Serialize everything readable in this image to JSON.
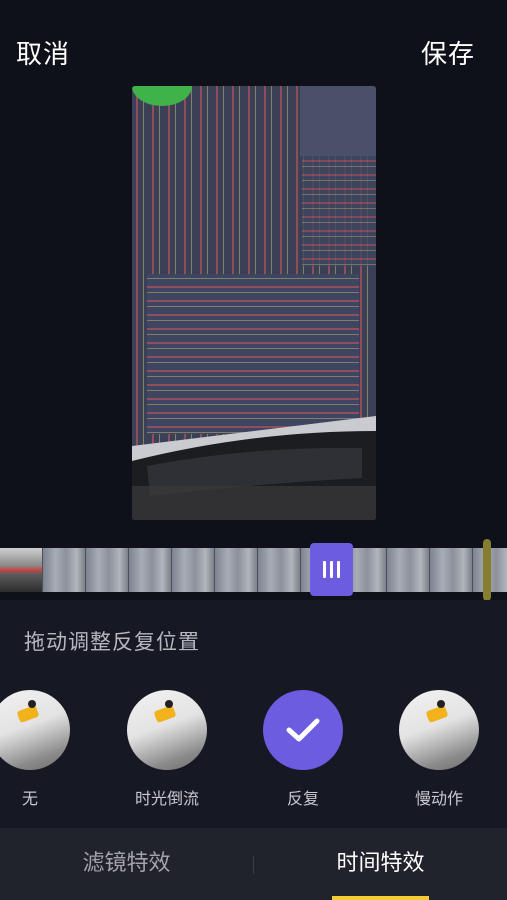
{
  "header": {
    "cancel_label": "取消",
    "save_label": "保存"
  },
  "timeline": {
    "frame_count": 12
  },
  "hint": "拖动调整反复位置",
  "effects": [
    {
      "label": "无",
      "selected": false
    },
    {
      "label": "时光倒流",
      "selected": false
    },
    {
      "label": "反复",
      "selected": true
    },
    {
      "label": "慢动作",
      "selected": false
    }
  ],
  "tabs": {
    "filter_label": "滤镜特效",
    "time_label": "时间特效",
    "active": "时间特效"
  },
  "colors": {
    "accent": "#6b5ce0",
    "tab_indicator": "#f3cc34",
    "background": "#0f111a"
  }
}
